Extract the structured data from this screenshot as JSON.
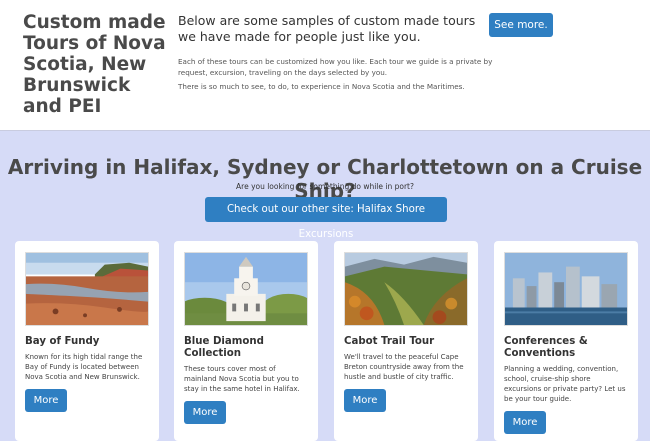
{
  "header": {
    "title": "Custom made Tours of Nova Scotia, New Brunswick and PEI",
    "intro": "Below are some samples of custom made tours we have made for people just like you.",
    "paragraph1": "Each of these tours can be customized how you like. Each tour we guide is a private by request, excursion, traveling on the days selected by you.",
    "paragraph2": "There is so much to see, to do, to experience in Nova Scotia and the Maritimes.",
    "see_more_label": "See more."
  },
  "cruise": {
    "heading": "Arriving in Halifax, Sydney or Charlottetown on a Cruise Ship?",
    "subtext": "Are you looking for something do while in port?",
    "button_label": "Check out our other site: Halifax Shore Excursions"
  },
  "cards": [
    {
      "title": "Bay of Fundy",
      "description": "Known for its high tidal range the Bay of Fundy is located between Nova Scotia and New Brunswick.",
      "button": "More",
      "image": "tidal-flats-photo"
    },
    {
      "title": "Blue Diamond Collection",
      "description": "These tours cover most of mainland Nova Scotia but you to stay in the same hotel in Halifax.",
      "button": "More",
      "image": "town-clock-photo"
    },
    {
      "title": "Cabot Trail Tour",
      "description": "We'll travel to the peaceful Cape Breton countryside away from the hustle and bustle of city traffic.",
      "button": "More",
      "image": "autumn-valley-photo"
    },
    {
      "title": "Conferences & Conventions",
      "description": "Planning a wedding, convention, school, cruise-ship shore excursions or private party? Let us be your tour guide.",
      "button": "More",
      "image": "city-skyline-photo"
    }
  ]
}
